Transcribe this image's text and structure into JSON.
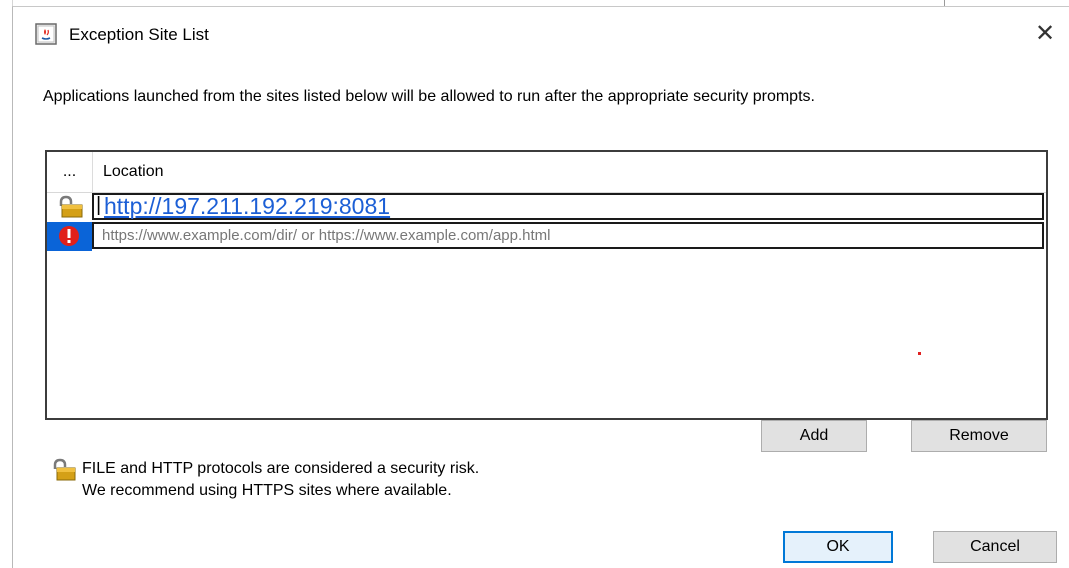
{
  "window": {
    "title": "Exception Site List",
    "close_label": "✕"
  },
  "description": "Applications launched from the sites listed below will be allowed to run after the appropriate security prompts.",
  "table": {
    "columns": [
      "...",
      "Location"
    ],
    "rows": [
      {
        "icon": "lock-warning-icon",
        "location": "http://197.211.192.219:8081",
        "editing": true
      },
      {
        "icon": "error-icon",
        "location": "https://www.example.com/dir/ or https://www.example.com/app.html",
        "placeholder": true
      }
    ]
  },
  "buttons": {
    "add": "Add",
    "remove": "Remove",
    "ok": "OK",
    "cancel": "Cancel"
  },
  "warning": {
    "icon": "lock-warning-icon",
    "line1": "FILE and HTTP protocols are considered a security risk.",
    "line2": "We recommend using HTTPS sites where available."
  },
  "colors": {
    "link": "#1c5fd6",
    "ok_border": "#0078d7",
    "error": "#e0201a"
  }
}
